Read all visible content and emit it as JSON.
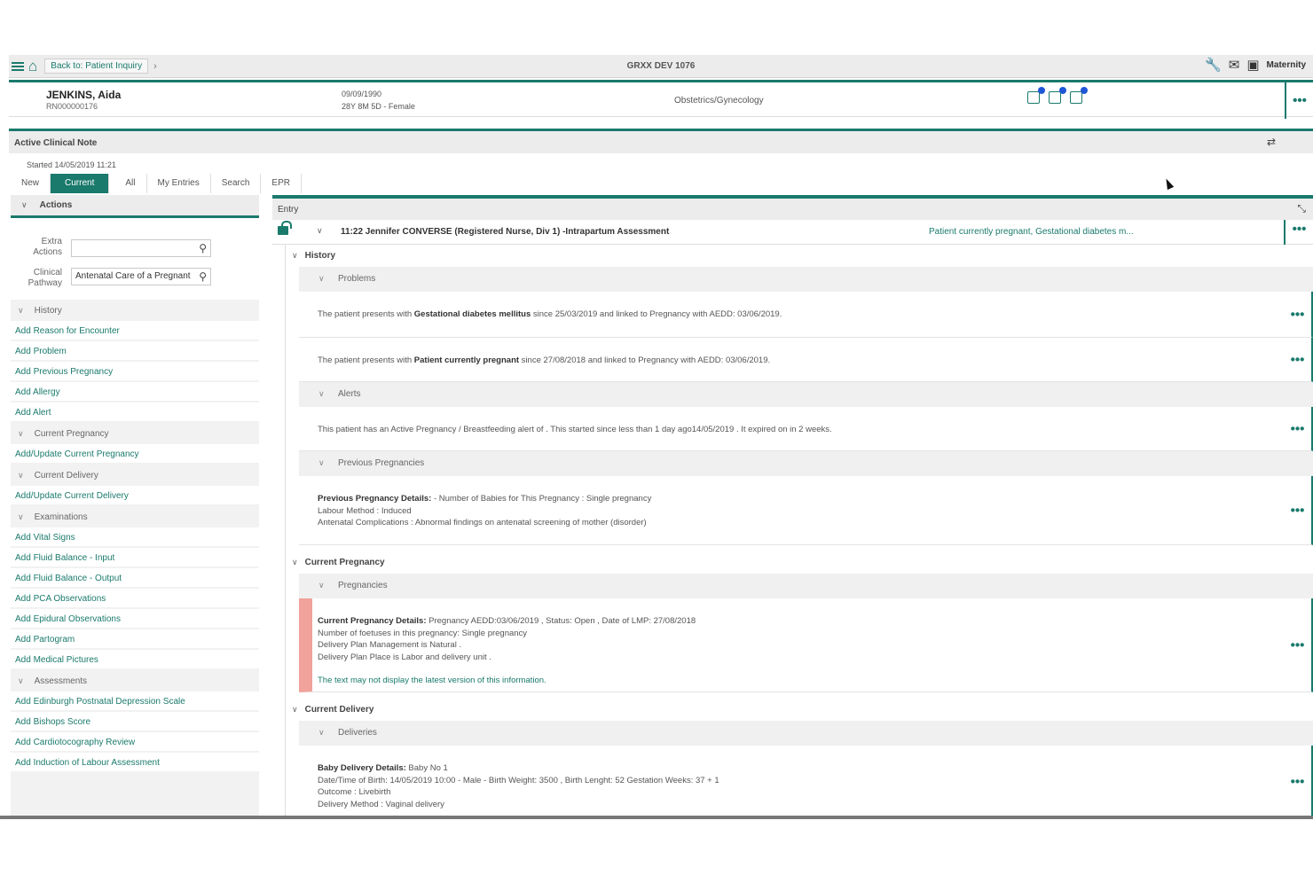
{
  "topbar": {
    "back_label": "Back to: Patient Inquiry",
    "chevron": "›",
    "system_title": "GRXX DEV 1076",
    "maternity_label": "Maternity"
  },
  "patient": {
    "name": "JENKINS, Aida",
    "mrn": "RN000000176",
    "dob": "09/09/1990",
    "age_gender": "28Y 8M 5D - Female",
    "specialty": "Obstetrics/Gynecology"
  },
  "clinical_note": {
    "section_title": "Active Clinical Note",
    "started": "Started  14/05/2019  11:21",
    "tabs": [
      "New",
      "Current",
      "All",
      "My Entries",
      "Search",
      "EPR"
    ],
    "active_tab": "Current"
  },
  "actions": {
    "title": "Actions",
    "extra_actions_label": "Extra Actions",
    "extra_actions_value": "",
    "clinical_pathway_label": "Clinical Pathway",
    "clinical_pathway_value": "Antenatal Care of a Pregnant",
    "groups": [
      {
        "title": "History",
        "items": [
          "Add Reason for Encounter",
          "Add Problem",
          "Add Previous Pregnancy",
          "Add Allergy",
          "Add Alert"
        ]
      },
      {
        "title": "Current Pregnancy",
        "items": [
          "Add/Update Current Pregnancy"
        ]
      },
      {
        "title": "Current Delivery",
        "items": [
          "Add/Update Current Delivery"
        ]
      },
      {
        "title": "Examinations",
        "items": [
          "Add Vital Signs",
          "Add Fluid Balance - Input",
          "Add Fluid Balance - Output",
          "Add PCA Observations",
          "Add Epidural Observations",
          "Add Partogram",
          "Add Medical Pictures"
        ]
      },
      {
        "title": "Assessments",
        "items": [
          "Add Edinburgh Postnatal Depression Scale",
          "Add Bishops Score",
          "Add Cardiotocography Review",
          "Add Induction of Labour Assessment"
        ]
      }
    ]
  },
  "entry": {
    "label": "Entry",
    "note_title": "11:22 Jennifer CONVERSE (Registered Nurse, Div 1) -Intrapartum Assessment",
    "note_summary": "Patient currently pregnant, Gestational diabetes m...",
    "history_label": "History",
    "problems_label": "Problems",
    "problem1_pre": "The patient presents with ",
    "problem1_bold": "Gestational diabetes mellitus",
    "problem1_post": " since 25/03/2019 and linked to Pregnancy with AEDD: 03/06/2019.",
    "problem2_pre": "The patient presents with ",
    "problem2_bold": "Patient currently pregnant",
    "problem2_post": " since 27/08/2018 and linked to Pregnancy with AEDD: 03/06/2019.",
    "alerts_label": "Alerts",
    "alert_text": "This patient has an Active Pregnancy / Breastfeeding alert of . This started since  less than 1 day ago14/05/2019 . It expired on  in 2 weeks.",
    "prev_preg_label": "Previous Pregnancies",
    "prev_preg_bold": "Previous Pregnancy Details:",
    "prev_preg_line1": " - Number of Babies for This Pregnancy : Single pregnancy",
    "prev_preg_line2": "Labour Method : Induced",
    "prev_preg_line3": "Antenatal Complications : Abnormal findings on antenatal screening of mother (disorder)",
    "current_preg_label": "Current Pregnancy",
    "pregnancies_label": "Pregnancies",
    "cur_preg_bold": "Current Pregnancy Details:",
    "cur_preg_line1": " Pregnancy AEDD:03/06/2019 , Status: Open , Date of LMP: 27/08/2018",
    "cur_preg_line2": "Number of foetuses in this pregnancy: Single pregnancy",
    "cur_preg_line3": "Delivery Plan Management is Natural .",
    "cur_preg_line4": "Delivery Plan Place is Labor and delivery unit .",
    "cur_preg_note": "The text may not display the latest version of this information.",
    "current_delivery_label": "Current Delivery",
    "deliveries_label": "Deliveries",
    "delivery_bold": "Baby Delivery Details:",
    "delivery_line1": " Baby No 1",
    "delivery_line2": "Date/Time of Birth: 14/05/2019 10:00 - Male - Birth Weight: 3500 , Birth Lenght: 52 Gestation Weeks: 37 + 1",
    "delivery_line3": "Outcome : Livebirth",
    "delivery_line4": "Delivery Method : Vaginal delivery"
  },
  "glyphs": {
    "more": "•••",
    "chevron_down": "∨",
    "search": "⚲",
    "home": "⌂",
    "wrench": "🔧",
    "mail": "✉",
    "person": "▣",
    "collapse": "⇄",
    "expand": "⤡"
  },
  "colors": {
    "accent": "#1a7a6c",
    "badge": "#1f56d6",
    "alert_stripe": "#f1a29a"
  }
}
